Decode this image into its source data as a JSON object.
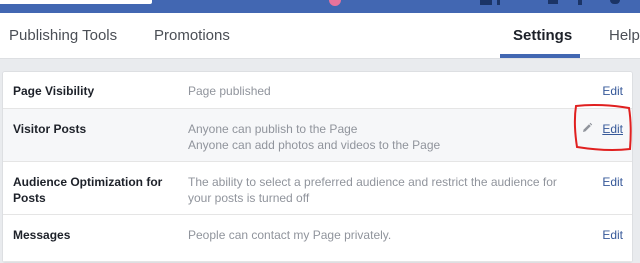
{
  "tabs": {
    "publishing_tools": "Publishing Tools",
    "promotions": "Promotions",
    "settings": "Settings",
    "help": "Help"
  },
  "settings_rows": [
    {
      "label": "Page Visibility",
      "value_lines": [
        "Page published"
      ],
      "edit": "Edit"
    },
    {
      "label": "Visitor Posts",
      "value_lines": [
        "Anyone can publish to the Page",
        "Anyone can add photos and videos to the Page"
      ],
      "edit": "Edit"
    },
    {
      "label": "Audience Optimization for Posts",
      "value_lines": [
        "The ability to select a preferred audience and restrict the audience for",
        "your posts is turned off"
      ],
      "edit": "Edit"
    },
    {
      "label": "Messages",
      "value_lines": [
        "People can contact my Page privately."
      ],
      "edit": "Edit"
    }
  ],
  "icons": {
    "pencil": "pencil-icon"
  },
  "colors": {
    "top_bar": "#4267b2",
    "link": "#365899",
    "annotation": "#e02020"
  }
}
